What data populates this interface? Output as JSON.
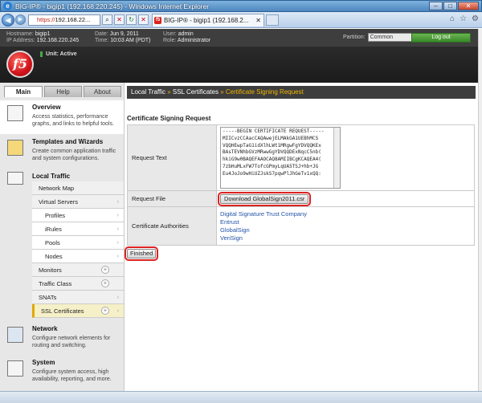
{
  "window": {
    "title": "BIG-IP® - bigip1 (192.168.220.245) - Windows Internet Explorer"
  },
  "browser": {
    "address_scheme": "https://",
    "address_host": "192.168.22...",
    "tab_label": "BIG-IP® - bigip1 (192.168.2..."
  },
  "header": {
    "hostname_label": "Hostname:",
    "hostname": "bigip1",
    "ip_label": "IP Address:",
    "ip": "192.168.220.245",
    "date_label": "Date:",
    "date": "Jun 9, 2011",
    "time_label": "Time:",
    "time": "10:03 AM (PDT)",
    "user_label": "User:",
    "user": "admin",
    "role_label": "Role:",
    "role": "Administrator",
    "partition_label": "Partition:",
    "partition_value": "Common",
    "logout": "Log out"
  },
  "brand": {
    "logo_text": "f5",
    "unit_status": "Unit: Active"
  },
  "sidebar": {
    "tabs": [
      "Main",
      "Help",
      "About"
    ],
    "overview": {
      "title": "Overview",
      "desc": "Access statistics, performance graphs, and links to helpful tools."
    },
    "templates": {
      "title": "Templates and Wizards",
      "desc": "Create common application traffic and system configurations."
    },
    "local_traffic": {
      "title": "Local Traffic"
    },
    "nav": [
      "Network Map",
      "Virtual Servers",
      "Profiles",
      "iRules",
      "Pools",
      "Nodes",
      "Monitors",
      "Traffic Class",
      "SNATs",
      "SSL Certificates"
    ],
    "network": {
      "title": "Network",
      "desc": "Configure network elements for routing and switching."
    },
    "system": {
      "title": "System",
      "desc": "Configure system access, high availability, reporting, and more."
    }
  },
  "breadcrumb": {
    "part1": "Local Traffic",
    "sep": "»",
    "part2": "SSL Certificates",
    "current": "Certificate Signing Request"
  },
  "csr": {
    "section_title": "Certificate Signing Request",
    "request_text_label": "Request Text",
    "request_text": "-----BEGIN CERTIFICATE REQUEST-----\nMIICvzCCAacCAQAwejELMAkGA1UEBhMCS\nVQQHEwpTaG1idXlhLWt1MRgwFgYDVQQKEx\nBAsTEVNhbGVzMRwwGgYDVQQDExNqcC5nb(\nhkiG9w0BAQEFAAOCAQ8AMIIBCgKCAQEA4(\n7zbHuMLxFW7TofcGPmyLqUA5TSJ+hb+JG\nEu4JoJo9wHiUZJskS7pqwPlJhGeTv1xQQ:",
    "request_file_label": "Request File",
    "download_button": "Download GlobalSign2011.csr",
    "ca_label": "Certificate Authorities",
    "cas": [
      "Digital Signature Trust Company",
      "Entrust",
      "GlobalSign",
      "VeriSign"
    ],
    "finished_button": "Finished"
  }
}
